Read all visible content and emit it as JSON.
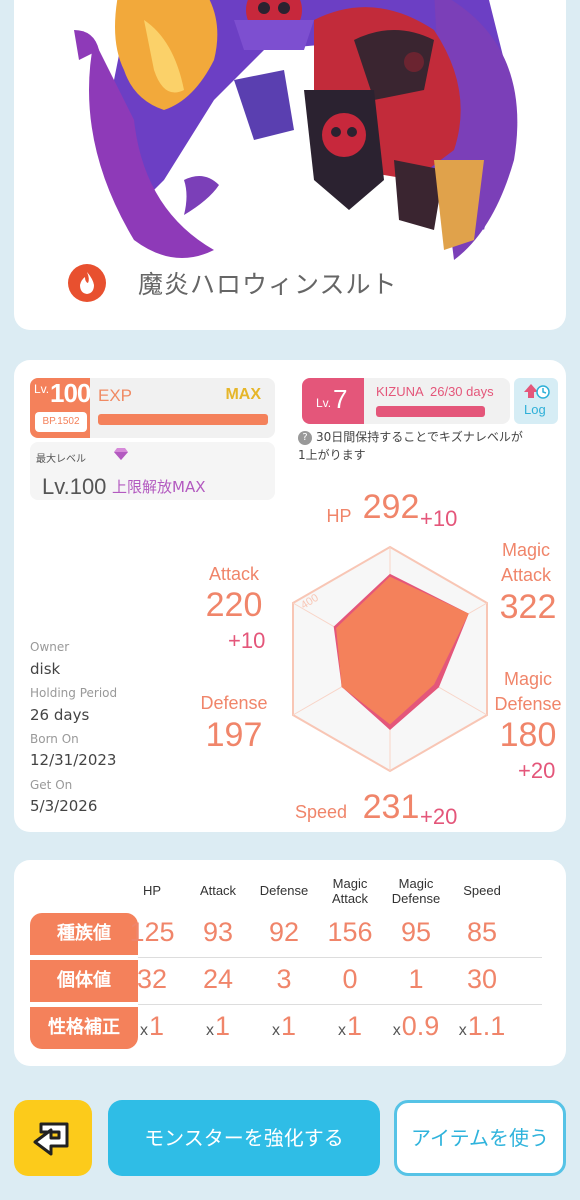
{
  "monster": {
    "name": "魔炎ハロウィンスルト",
    "element_icon": "fire-icon"
  },
  "level": {
    "lv_prefix": "Lv.",
    "lv_value": "100",
    "bp": "BP.1502",
    "exp_label": "EXP",
    "exp_status": "MAX",
    "exp_progress": 1.0,
    "max_level_label": "最大レベル",
    "max_level_value": "Lv.100",
    "limit_break": "上限解放MAX"
  },
  "kizuna": {
    "lv_prefix": "Lv.",
    "lv_value": "7",
    "title": "KIZUNA",
    "days": "26/30 days",
    "progress": 0.8667,
    "log_label": "Log",
    "note": "30日間保持することでキズナレベルが1上がります"
  },
  "owner_info": {
    "owner_label": "Owner",
    "owner_value": "disk",
    "holding_label": "Holding Period",
    "holding_value": "26 days",
    "born_label": "Born On",
    "born_value": "12/31/2023",
    "get_label": "Get On",
    "get_value": "5/3/2026"
  },
  "stats": {
    "hp": {
      "label": "HP",
      "value": "292",
      "bonus": "+10"
    },
    "attack": {
      "label": "Attack",
      "value": "220",
      "bonus": "+10"
    },
    "magic_attack": {
      "label": "Magic Attack",
      "label_1": "Magic",
      "label_2": "Attack",
      "value": "322"
    },
    "defense": {
      "label": "Defense",
      "value": "197"
    },
    "magic_defense": {
      "label": "Magic Defense",
      "label_1": "Magic",
      "label_2": "Defense",
      "value": "180",
      "bonus": "+20"
    },
    "speed": {
      "label": "Speed",
      "value": "231",
      "bonus": "+20"
    }
  },
  "chart_data": {
    "type": "radar",
    "axes": [
      "HP",
      "Magic Attack",
      "Magic Defense",
      "Speed",
      "Defense",
      "Attack"
    ],
    "max": 400,
    "scale_label": "400",
    "series": [
      {
        "values": [
          302,
          322,
          200,
          251,
          197,
          230
        ],
        "color": "#e4567a"
      },
      {
        "values": [
          292,
          322,
          180,
          231,
          197,
          220
        ],
        "color": "#f4815b"
      }
    ]
  },
  "table": {
    "headers": [
      "HP",
      "Attack",
      "Defense",
      "Magic Attack",
      "Magic Defense",
      "Speed"
    ],
    "header_lines": [
      [
        "HP"
      ],
      [
        "Attack"
      ],
      [
        "Defense"
      ],
      [
        "Magic",
        "Attack"
      ],
      [
        "Magic",
        "Defense"
      ],
      [
        "Speed"
      ]
    ],
    "rows": [
      {
        "label": "種族値",
        "values": [
          "125",
          "93",
          "92",
          "156",
          "95",
          "85"
        ]
      },
      {
        "label": "個体値",
        "values": [
          "32",
          "24",
          "3",
          "0",
          "1",
          "30"
        ]
      },
      {
        "label": "性格補正",
        "prefix": "x",
        "values": [
          "1",
          "1",
          "1",
          "1",
          "0.9",
          "1.1"
        ]
      }
    ]
  },
  "buttons": {
    "back_icon": "return-arrow-icon",
    "power_up": "モンスターを強化する",
    "use_item": "アイテムを使う"
  },
  "colors": {
    "orange": "#f4815b",
    "pink": "#e4567a",
    "blue": "#2fbde6",
    "yellow": "#fccb1b"
  }
}
